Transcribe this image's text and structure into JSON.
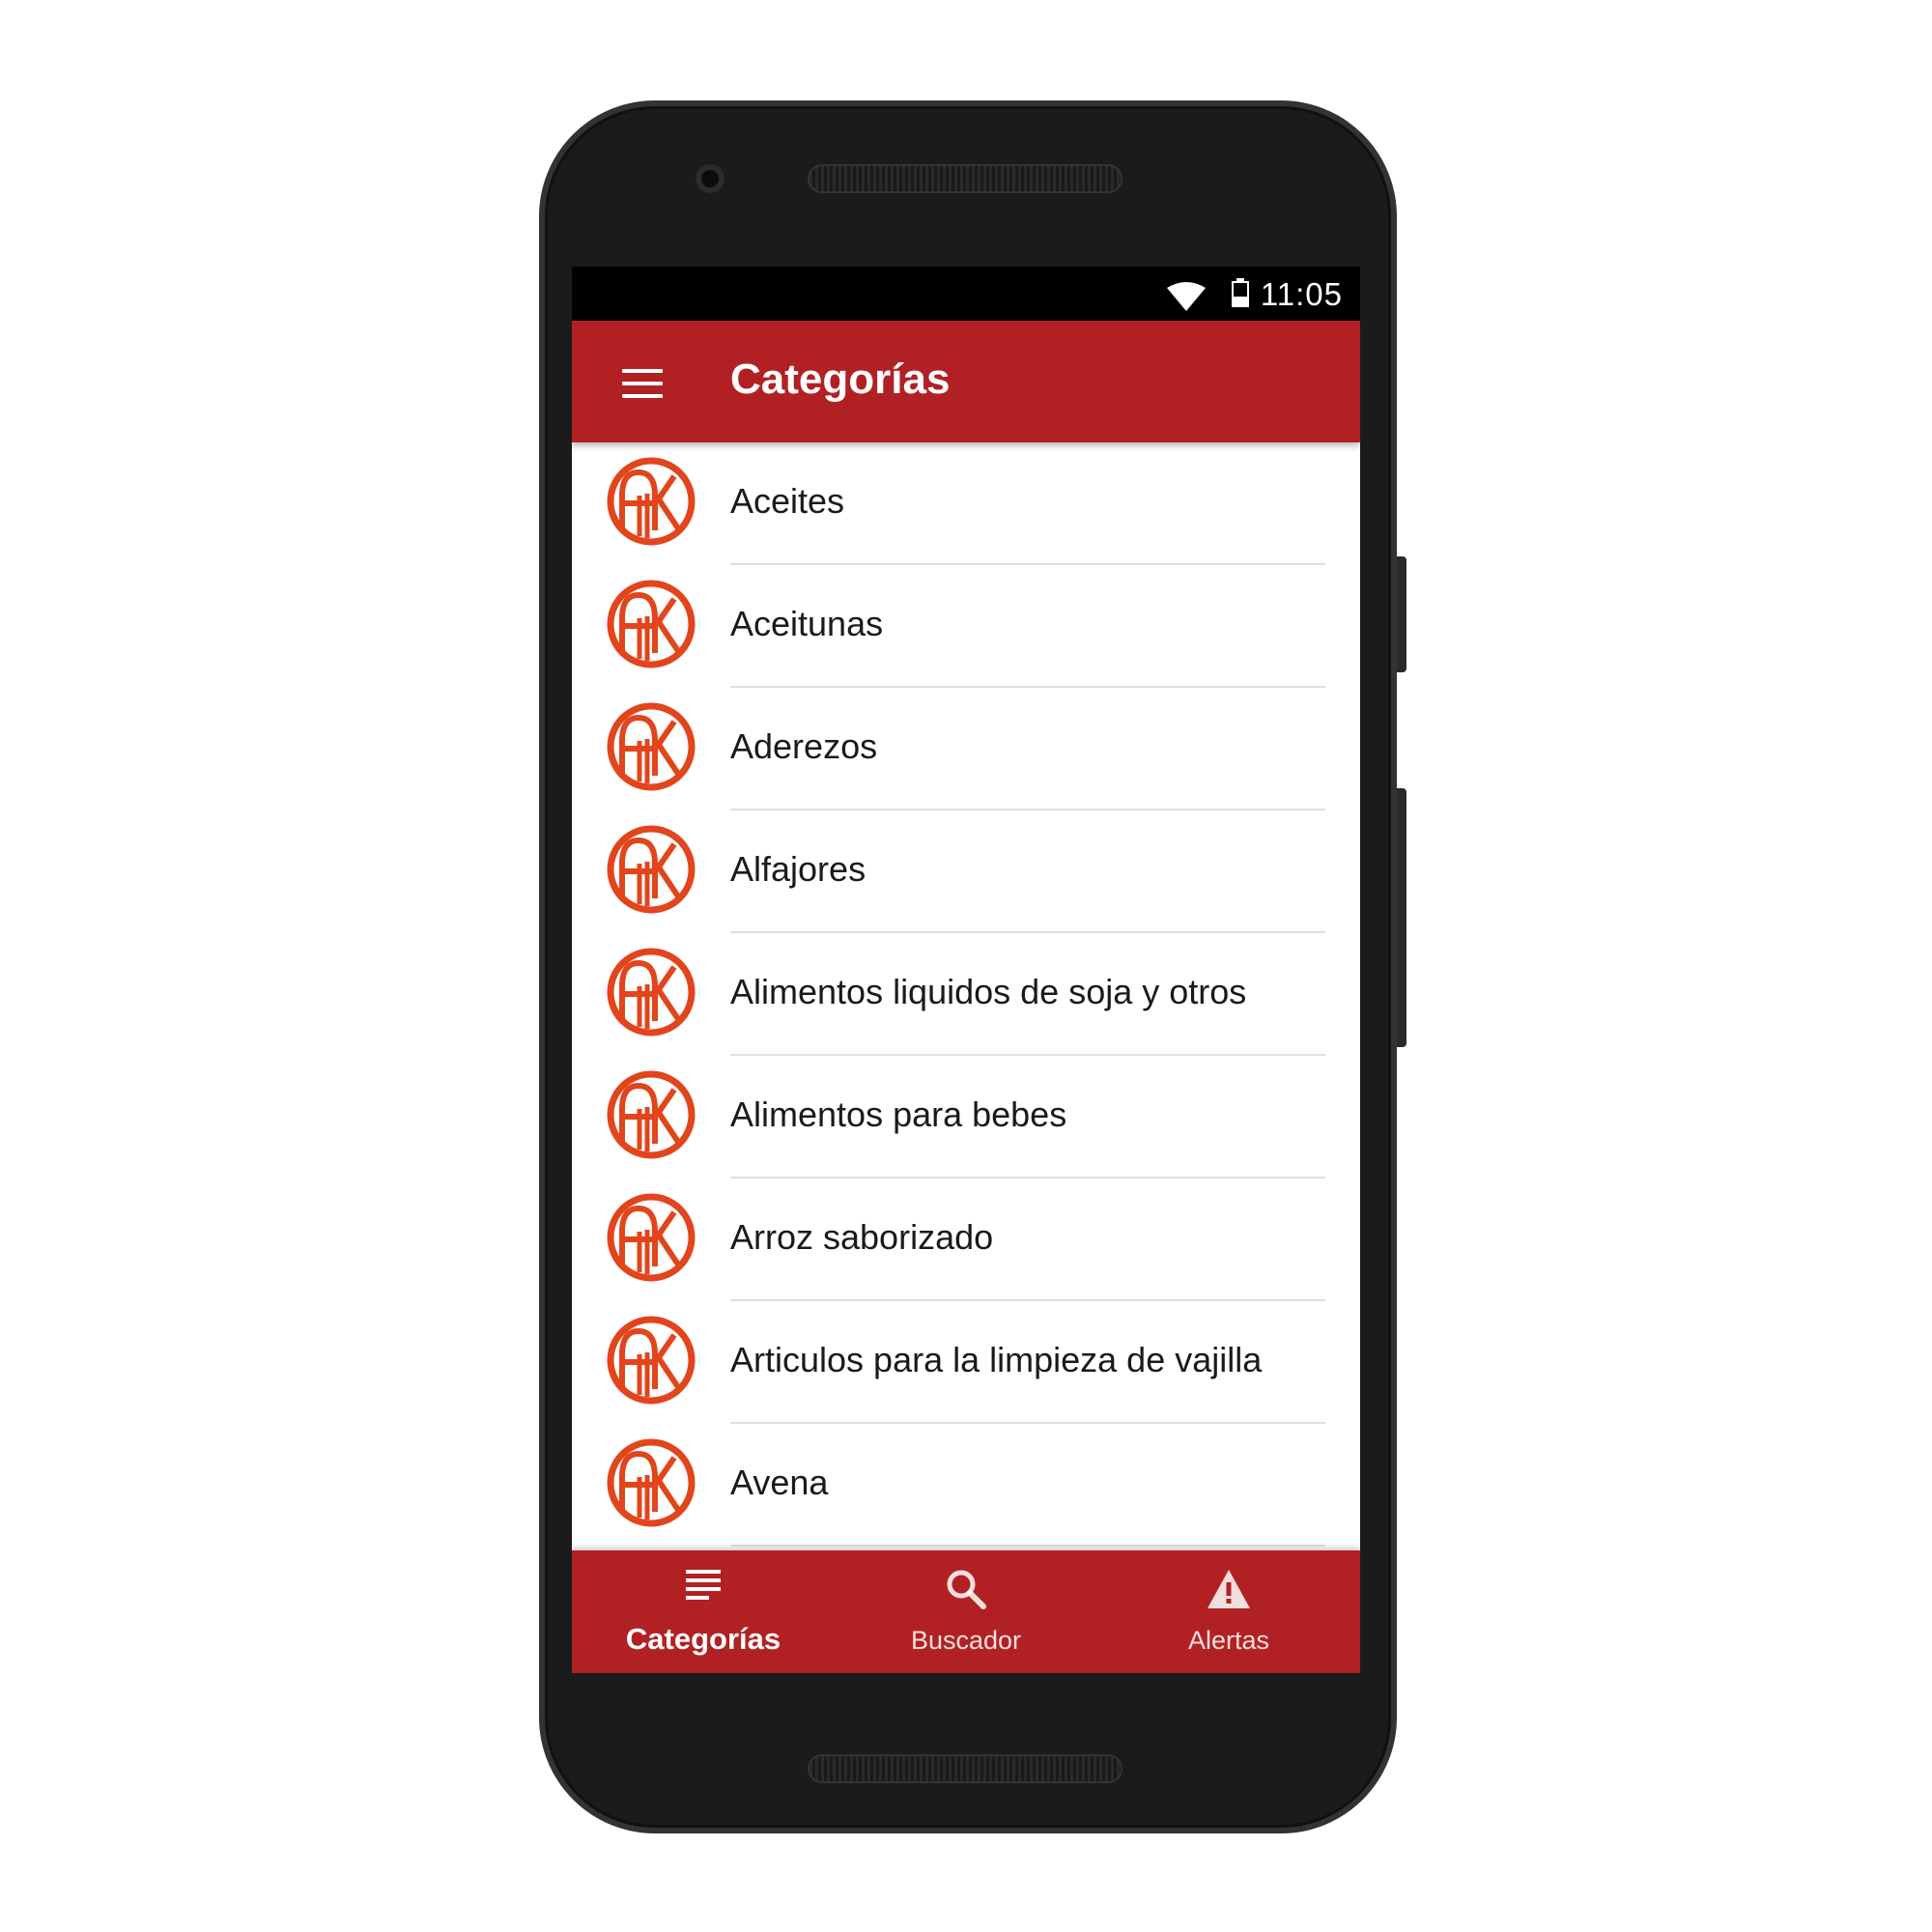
{
  "status_bar": {
    "time": "11:05",
    "icons": [
      "wifi-icon",
      "battery-icon"
    ]
  },
  "app_bar": {
    "title": "Categorías",
    "menu_icon": "menu-icon"
  },
  "categories": [
    {
      "label": "Aceites",
      "icon": "ak-logo-icon"
    },
    {
      "label": "Aceitunas",
      "icon": "ak-logo-icon"
    },
    {
      "label": "Aderezos",
      "icon": "ak-logo-icon"
    },
    {
      "label": "Alfajores",
      "icon": "ak-logo-icon"
    },
    {
      "label": "Alimentos liquidos de soja y otros",
      "icon": "ak-logo-icon"
    },
    {
      "label": "Alimentos para bebes",
      "icon": "ak-logo-icon"
    },
    {
      "label": "Arroz saborizado",
      "icon": "ak-logo-icon"
    },
    {
      "label": "Articulos para la limpieza de vajilla",
      "icon": "ak-logo-icon"
    },
    {
      "label": "Avena",
      "icon": "ak-logo-icon"
    }
  ],
  "bottom_nav": {
    "items": [
      {
        "label": "Categorías",
        "icon": "list-icon",
        "active": true
      },
      {
        "label": "Buscador",
        "icon": "search-icon",
        "active": false
      },
      {
        "label": "Alertas",
        "icon": "warning-icon",
        "active": false
      }
    ]
  },
  "colors": {
    "primary": "#b12124",
    "logo": "#e2451c",
    "status_bar": "#000000",
    "device": "#1b1b1b"
  }
}
